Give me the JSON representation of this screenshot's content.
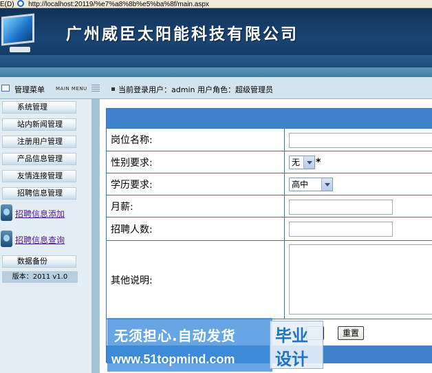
{
  "browser": {
    "menu_fragment": "E(D)",
    "url": "http://localhost:20119/%e7%a8%8b%e5%ba%8f/main.aspx"
  },
  "banner": {
    "company_name": "广州威臣太阳能科技有限公司"
  },
  "infobar": {
    "menu_title": "管理菜单",
    "menu_title_en": "MAIN MENU",
    "user_info": "当前登录用户：admin  用户角色：超级管理员"
  },
  "sidebar": {
    "items": [
      {
        "label": "系统管理"
      },
      {
        "label": "站内新闻管理"
      },
      {
        "label": "注册用户管理"
      },
      {
        "label": "产品信息管理"
      },
      {
        "label": "友情连接管理"
      },
      {
        "label": "招聘信息管理"
      }
    ],
    "subitems": [
      {
        "label": "招聘信息添加",
        "icon": "document-icon"
      },
      {
        "label": "招聘信息查询",
        "icon": "document-icon"
      }
    ],
    "backup": "数据备份",
    "version": "版本：2011 v1.0"
  },
  "form": {
    "position_label": "岗位名称:",
    "gender_label": "性别要求:",
    "gender_value": "无",
    "required_mark": "*",
    "education_label": "学历要求:",
    "education_value": "高中",
    "salary_label": "月薪:",
    "headcount_label": "招聘人数:",
    "notes_label": "其他说明:",
    "reset_button": "重置"
  },
  "watermark": {
    "line1": "无须担心.自动发货",
    "line2": "www.51topmind.com",
    "right1": "毕业",
    "right2": "设计"
  }
}
